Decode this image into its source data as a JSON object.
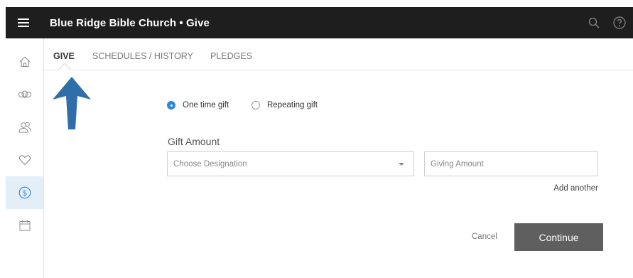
{
  "header": {
    "title": "Blue Ridge Bible Church • Give",
    "icons": {
      "menu": "hamburger-menu-icon",
      "search": "search-icon",
      "help": "help-icon"
    }
  },
  "sidebar": {
    "items": [
      {
        "icon": "home-icon",
        "active": false
      },
      {
        "icon": "community-icon",
        "active": false
      },
      {
        "icon": "people-icon",
        "active": false
      },
      {
        "icon": "heart-icon",
        "active": false
      },
      {
        "icon": "dollar-icon",
        "active": true
      },
      {
        "icon": "calendar-icon",
        "active": false
      }
    ]
  },
  "tabs": [
    {
      "label": "GIVE",
      "active": true
    },
    {
      "label": "SCHEDULES / HISTORY",
      "active": false
    },
    {
      "label": "PLEDGES",
      "active": false
    }
  ],
  "form": {
    "gift_type": {
      "one_time": "One time gift",
      "repeating": "Repeating gift",
      "selected": "One time gift"
    },
    "gift_amount_label": "Gift Amount",
    "designation_placeholder": "Choose Designation",
    "amount_placeholder": "Giving Amount",
    "add_another": "Add another",
    "cancel": "Cancel",
    "continue": "Continue"
  },
  "colors": {
    "topbar": "#1e1e1e",
    "radio_selected": "#2a86e0",
    "active_nav_bg": "#e3eef8",
    "callout_arrow": "#2f6ea8",
    "continue_button": "#5f5f5f"
  }
}
